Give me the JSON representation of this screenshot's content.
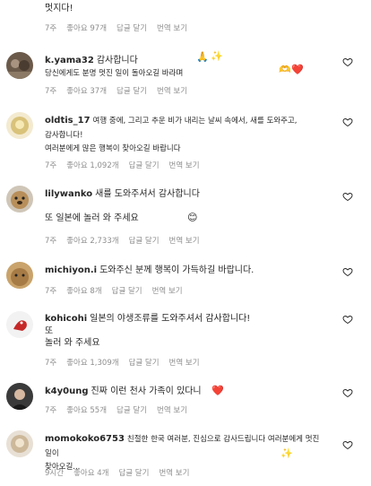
{
  "top_fragment": {
    "text": "멋지다!",
    "time": "7주",
    "likes": "좋아요 97개",
    "reply": "답글 달기",
    "translate": "번역 보기"
  },
  "comments": [
    {
      "username": "k.yama32",
      "text": "감사합니다",
      "text2": "당신에게도 분명 멋진 일이 돌아오길 바라며",
      "time": "7주",
      "likes": "좋아요 37개",
      "reply": "답글 달기",
      "translate": "번역 보기"
    },
    {
      "username": "oldtis_17",
      "text": "여행 중에, 그리고 추운 비가 내리는 날씨 속에서, 새를 도와주고, 감사합니다!",
      "text2": "여러분에게 많은 행복이 찾아오길 바랍니다",
      "time": "7주",
      "likes": "좋아요 1,092개",
      "reply": "답글 달기",
      "translate": "번역 보기"
    },
    {
      "username": "lilywanko",
      "text": "새를 도와주셔서 감사합니다",
      "text2": "또 일본에 놀러 와 주세요",
      "time": "7주",
      "likes": "좋아요 2,733개",
      "reply": "답글 달기",
      "translate": "번역 보기"
    },
    {
      "username": "michiyon.i",
      "text": "도와주신 분께 행복이 가득하길 바랍니다.",
      "time": "7주",
      "likes": "좋아요 8개",
      "reply": "답글 달기",
      "translate": "번역 보기"
    },
    {
      "username": "kohicohi",
      "text": "일본의 야생조류를 도와주셔서 감사합니다!",
      "text2": "또",
      "text3": "놀러 와 주세요",
      "time": "7주",
      "likes": "좋아요 1,309개",
      "reply": "답글 달기",
      "translate": "번역 보기"
    },
    {
      "username": "k4y0ung",
      "text": "진짜 이런 천사 가족이 있다니",
      "time": "7주",
      "likes": "좋아요 55개",
      "reply": "답글 달기",
      "translate": "번역 보기"
    },
    {
      "username": "momokoko6753",
      "text": "친절한 한국 여러분, 진심으로 감사드립니다 여러분에게 멋진 일이",
      "text2": "찾아오길...",
      "time": "9시간",
      "likes": "좋아요 4개",
      "reply": "답글 달기",
      "translate": "번역 보기"
    }
  ],
  "icons": {
    "like": "heart-outline-icon",
    "accent_heart": "#e0245e"
  }
}
